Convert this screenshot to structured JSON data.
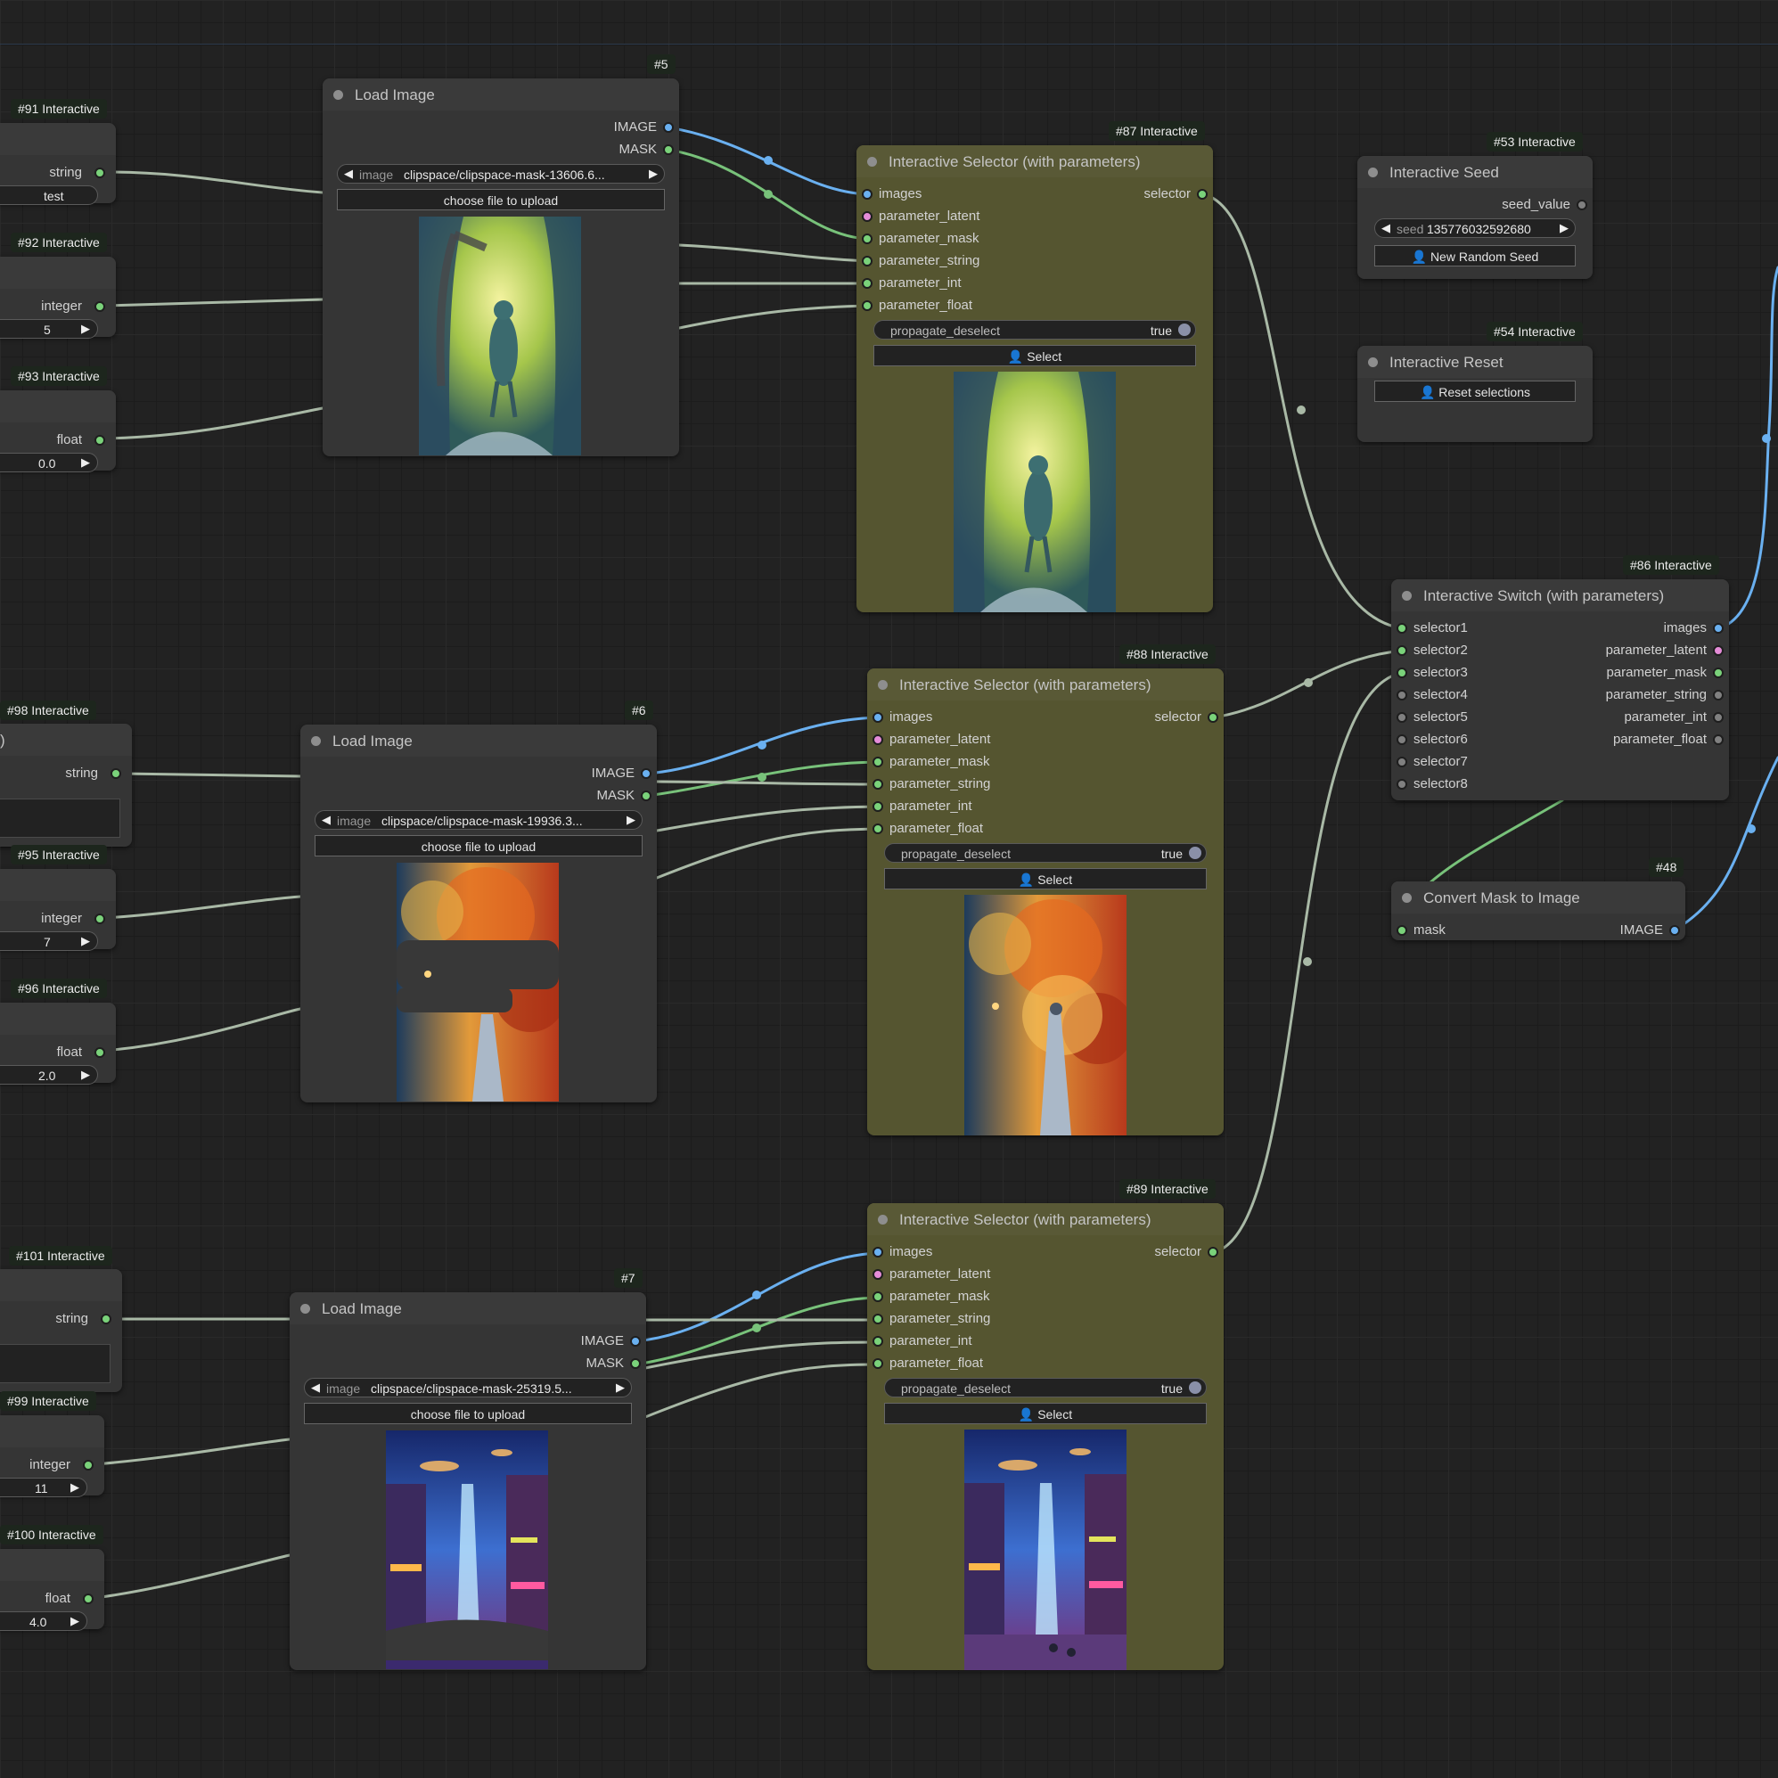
{
  "colors": {
    "canvas": "#222222",
    "node": "#353535",
    "olive_node": "#555530",
    "link_grey": "#a9b9a6",
    "link_blue": "#6ab0f0",
    "link_green": "#78c27a"
  },
  "nodes": {
    "n91": {
      "badge": "#91 Interactive",
      "out": "string",
      "value": "test"
    },
    "n92": {
      "badge": "#92 Interactive",
      "out": "integer",
      "value": "5"
    },
    "n93": {
      "badge": "#93 Interactive",
      "out": "float",
      "value": "0.0"
    },
    "n98": {
      "badge": "#98 Interactive",
      "out": "string",
      "frag": ")"
    },
    "n95": {
      "badge": "#95 Interactive",
      "out": "integer",
      "value": "7"
    },
    "n96": {
      "badge": "#96 Interactive",
      "out": "float",
      "value": "2.0"
    },
    "n101": {
      "badge": "#101 Interactive",
      "out": "string"
    },
    "n99": {
      "badge": "#99 Interactive",
      "out": "integer",
      "value": "11"
    },
    "n100": {
      "badge": "#100 Interactive",
      "out": "float",
      "value": "4.0"
    },
    "load5": {
      "badge": "#5",
      "title": "Load Image",
      "out_image": "IMAGE",
      "out_mask": "MASK",
      "widget_name": "image",
      "widget_value": "clipspace/clipspace-mask-13606.6...",
      "upload": "choose file to upload"
    },
    "load6": {
      "badge": "#6",
      "title": "Load Image",
      "out_image": "IMAGE",
      "out_mask": "MASK",
      "widget_name": "image",
      "widget_value": "clipspace/clipspace-mask-19936.3...",
      "upload": "choose file to upload"
    },
    "load7": {
      "badge": "#7",
      "title": "Load Image",
      "out_image": "IMAGE",
      "out_mask": "MASK",
      "widget_name": "image",
      "widget_value": "clipspace/clipspace-mask-25319.5...",
      "upload": "choose file to upload"
    },
    "sel87": {
      "badge": "#87 Interactive",
      "title": "Interactive Selector (with parameters)",
      "inputs": [
        "images",
        "parameter_latent",
        "parameter_mask",
        "parameter_string",
        "parameter_int",
        "parameter_float"
      ],
      "output": "selector",
      "toggle_name": "propagate_deselect",
      "toggle_value": "true",
      "button": "👤 Select"
    },
    "sel88": {
      "badge": "#88 Interactive",
      "title": "Interactive Selector (with parameters)",
      "inputs": [
        "images",
        "parameter_latent",
        "parameter_mask",
        "parameter_string",
        "parameter_int",
        "parameter_float"
      ],
      "output": "selector",
      "toggle_name": "propagate_deselect",
      "toggle_value": "true",
      "button": "👤 Select"
    },
    "sel89": {
      "badge": "#89 Interactive",
      "title": "Interactive Selector (with parameters)",
      "inputs": [
        "images",
        "parameter_latent",
        "parameter_mask",
        "parameter_string",
        "parameter_int",
        "parameter_float"
      ],
      "output": "selector",
      "toggle_name": "propagate_deselect",
      "toggle_value": "true",
      "button": "👤 Select"
    },
    "seed53": {
      "badge": "#53 Interactive",
      "title": "Interactive Seed",
      "output": "seed_value",
      "widget_name": "seed",
      "widget_value": "1357760325926​80",
      "button": "👤 New Random Seed"
    },
    "reset54": {
      "badge": "#54 Interactive",
      "title": "Interactive Reset",
      "button": "👤 Reset selections"
    },
    "switch86": {
      "badge": "#86 Interactive",
      "title": "Interactive Switch (with parameters)",
      "inputs": [
        "selector1",
        "selector2",
        "selector3",
        "selector4",
        "selector5",
        "selector6",
        "selector7",
        "selector8"
      ],
      "outputs": [
        "images",
        "parameter_latent",
        "parameter_mask",
        "parameter_string",
        "parameter_int",
        "parameter_float"
      ]
    },
    "convert48": {
      "badge": "#48",
      "title": "Convert Mask to Image",
      "input": "mask",
      "output": "IMAGE"
    }
  }
}
